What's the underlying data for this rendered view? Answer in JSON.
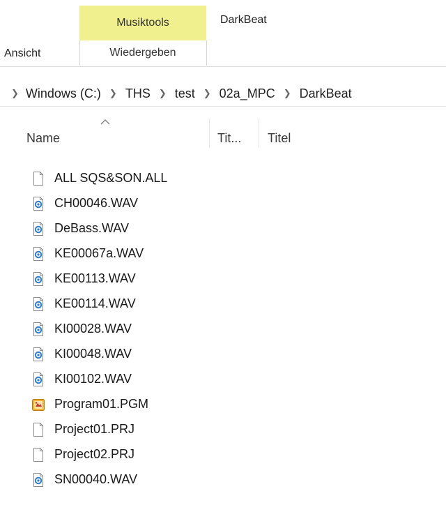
{
  "ribbon": {
    "context_tab_label": "Musiktools",
    "window_title": "DarkBeat",
    "tabs": [
      {
        "label": "Ansicht"
      },
      {
        "label": "Wiedergeben"
      }
    ],
    "context_tab_color": "#f0f08e"
  },
  "address": {
    "crumbs": [
      "Windows (C:)",
      "THS",
      "test",
      "02a_MPC",
      "DarkBeat"
    ]
  },
  "columns": {
    "name": "Name",
    "tit": "Tit...",
    "titel": "Titel"
  },
  "files": [
    {
      "name": "ALL SQS&SON.ALL",
      "icon": "generic-file-icon"
    },
    {
      "name": "CH00046.WAV",
      "icon": "audio-file-icon"
    },
    {
      "name": "DeBass.WAV",
      "icon": "audio-file-icon"
    },
    {
      "name": "KE00067a.WAV",
      "icon": "audio-file-icon"
    },
    {
      "name": "KE00113.WAV",
      "icon": "audio-file-icon"
    },
    {
      "name": "KE00114.WAV",
      "icon": "audio-file-icon"
    },
    {
      "name": "KI00028.WAV",
      "icon": "audio-file-icon"
    },
    {
      "name": "KI00048.WAV",
      "icon": "audio-file-icon"
    },
    {
      "name": "KI00102.WAV",
      "icon": "audio-file-icon"
    },
    {
      "name": "Program01.PGM",
      "icon": "program-file-icon"
    },
    {
      "name": "Project01.PRJ",
      "icon": "generic-file-icon"
    },
    {
      "name": "Project02.PRJ",
      "icon": "generic-file-icon"
    },
    {
      "name": "SN00040.WAV",
      "icon": "audio-file-icon"
    }
  ]
}
